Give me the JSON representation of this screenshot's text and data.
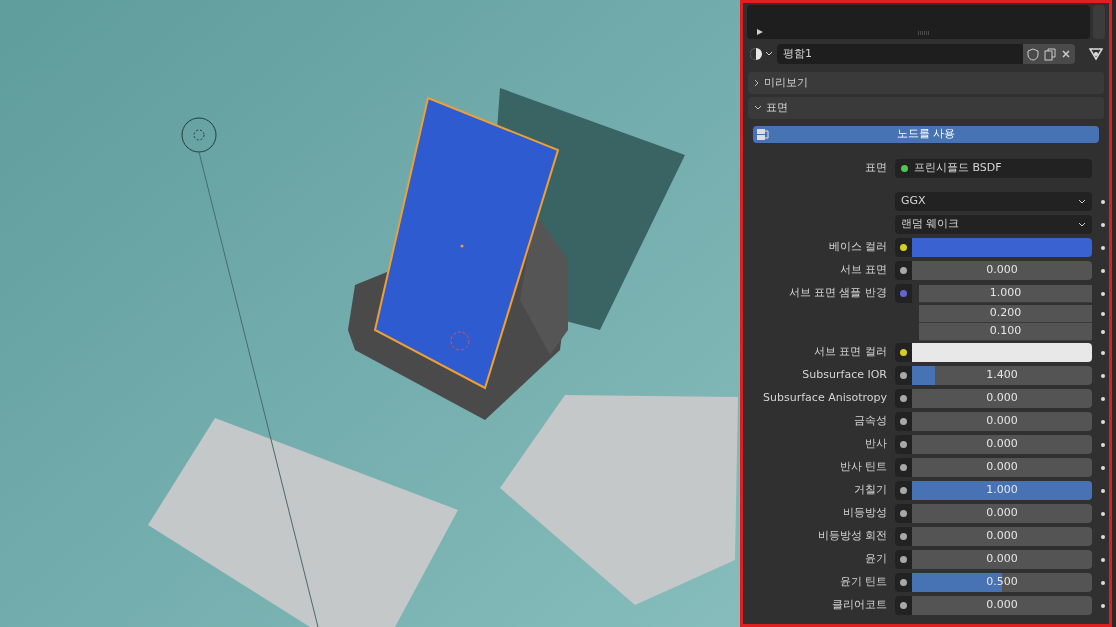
{
  "material": {
    "name": "평함1"
  },
  "sections": [
    {
      "title": "미리보기",
      "expanded": false
    },
    {
      "title": "표면",
      "expanded": true
    }
  ],
  "use_nodes_button": "노드를 사용",
  "properties": [
    {
      "kind": "shader",
      "label": "표면",
      "value": "프린시플드 BSDF",
      "color": "#4cc84c"
    },
    {
      "kind": "dropdown",
      "value": "GGX"
    },
    {
      "kind": "dropdown",
      "value": "랜덤 웨이크"
    },
    {
      "kind": "color",
      "label": "베이스 컬러",
      "color": "#d8d020",
      "swatch": {
        "color": "#3a62d0"
      }
    },
    {
      "kind": "slider",
      "label": "서브 표면",
      "color": "#a8a8a8",
      "value": "0.000",
      "level": 0
    },
    {
      "kind": "vector",
      "label": "서브 표면 샘플 반경",
      "color": "#6464d8",
      "values": [
        "1.000",
        "0.200",
        "0.100"
      ]
    },
    {
      "kind": "color",
      "label": "서브 표면 컬러",
      "color": "#d8d020",
      "swatch": {
        "color": "#e8e8e8"
      }
    },
    {
      "kind": "slider",
      "label": "Subsurface IOR",
      "color": "#a8a8a8",
      "value": "1.400",
      "level": 0.13
    },
    {
      "kind": "slider",
      "label": "Subsurface Anisotropy",
      "color": "#a8a8a8",
      "value": "0.000",
      "level": 0
    },
    {
      "kind": "slider",
      "label": "금속성",
      "color": "#a8a8a8",
      "value": "0.000",
      "level": 0
    },
    {
      "kind": "slider",
      "label": "반사",
      "color": "#a8a8a8",
      "value": "0.000",
      "level": 0
    },
    {
      "kind": "slider",
      "label": "반사 틴트",
      "color": "#a8a8a8",
      "value": "0.000",
      "level": 0
    },
    {
      "kind": "slider",
      "label": "거칠기",
      "color": "#a8a8a8",
      "value": "1.000",
      "level": 1
    },
    {
      "kind": "slider",
      "label": "비등방성",
      "color": "#a8a8a8",
      "value": "0.000",
      "level": 0
    },
    {
      "kind": "slider",
      "label": "비등방성 회전",
      "color": "#a8a8a8",
      "value": "0.000",
      "level": 0
    },
    {
      "kind": "slider",
      "label": "윤기",
      "color": "#a8a8a8",
      "value": "0.000",
      "level": 0
    },
    {
      "kind": "slider",
      "label": "윤기 틴트",
      "color": "#a8a8a8",
      "value": "0.500",
      "level": 0.5
    },
    {
      "kind": "slider",
      "label": "클리어코트",
      "color": "#a8a8a8",
      "value": "0.000",
      "level": 0
    }
  ]
}
